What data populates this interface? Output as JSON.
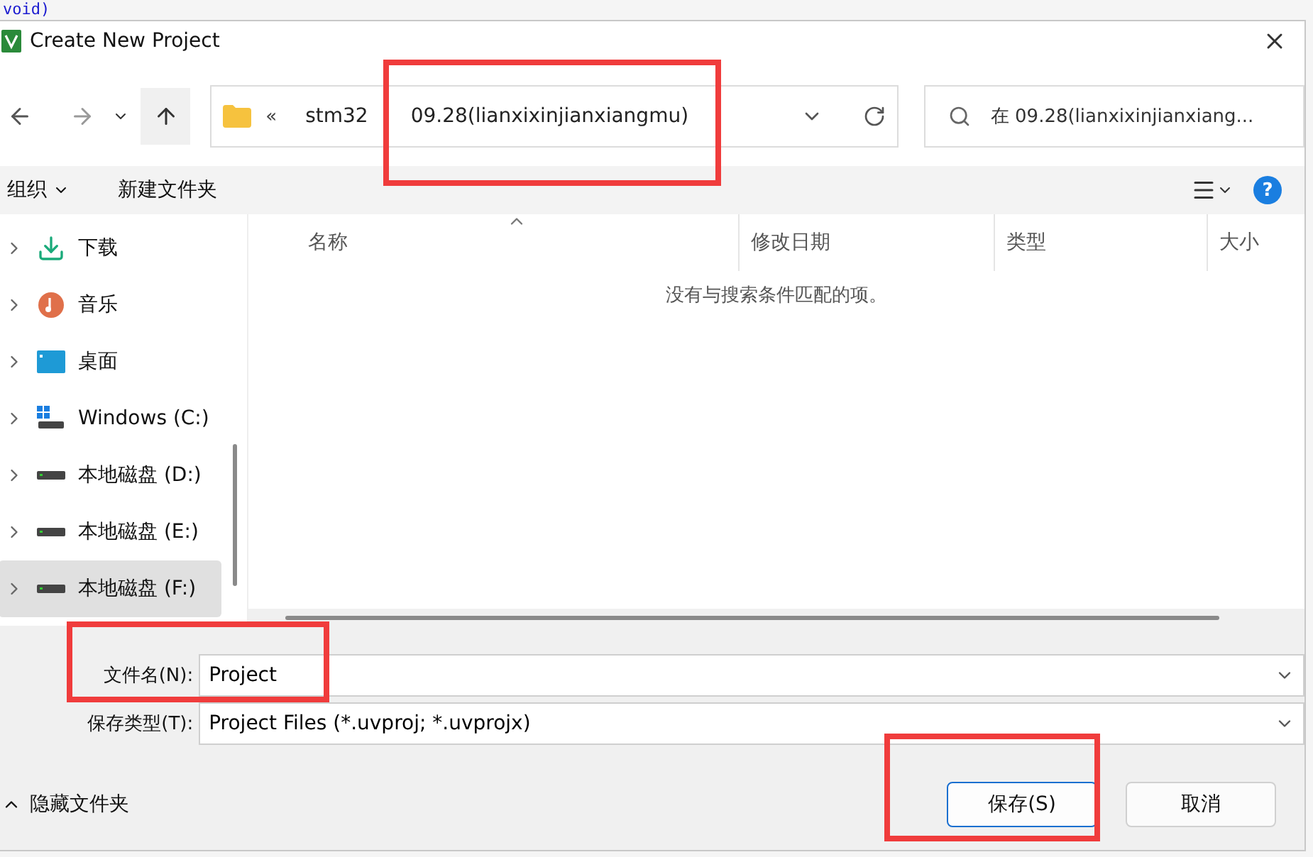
{
  "background_code": "void)",
  "window": {
    "title": "Create New Project"
  },
  "address_bar": {
    "overflow": "«",
    "breadcrumbs": [
      "stm32",
      "09.28(lianxixinjianxiangmu)"
    ]
  },
  "search": {
    "placeholder": "在 09.28(lianxixinjianxiang..."
  },
  "toolbar": {
    "organize": "组织",
    "new_folder": "新建文件夹",
    "help": "?"
  },
  "sidebar": {
    "items": [
      {
        "kind": "download",
        "label": "下载",
        "selected": false
      },
      {
        "kind": "music",
        "label": "音乐",
        "selected": false
      },
      {
        "kind": "desktop",
        "label": "桌面",
        "selected": false
      },
      {
        "kind": "system-drive",
        "label": "Windows (C:)",
        "selected": false
      },
      {
        "kind": "drive",
        "label": "本地磁盘 (D:)",
        "selected": false
      },
      {
        "kind": "drive",
        "label": "本地磁盘 (E:)",
        "selected": false
      },
      {
        "kind": "drive",
        "label": "本地磁盘 (F:)",
        "selected": true
      }
    ]
  },
  "table": {
    "columns": [
      "名称",
      "修改日期",
      "类型",
      "大小"
    ],
    "empty_message": "没有与搜索条件匹配的项。"
  },
  "file_name": {
    "label": "文件名(N):",
    "value": "Project"
  },
  "file_type": {
    "label": "保存类型(T):",
    "value": "Project Files (*.uvproj; *.uvprojx)"
  },
  "hide_folders": "隐藏文件夹",
  "buttons": [
    {
      "label": "保存(S)",
      "kind": "primary"
    },
    {
      "label": "取消",
      "kind": "secondary"
    }
  ],
  "annotations": [
    {
      "kind": "highlight"
    },
    {
      "kind": "highlight"
    },
    {
      "kind": "highlight"
    }
  ]
}
